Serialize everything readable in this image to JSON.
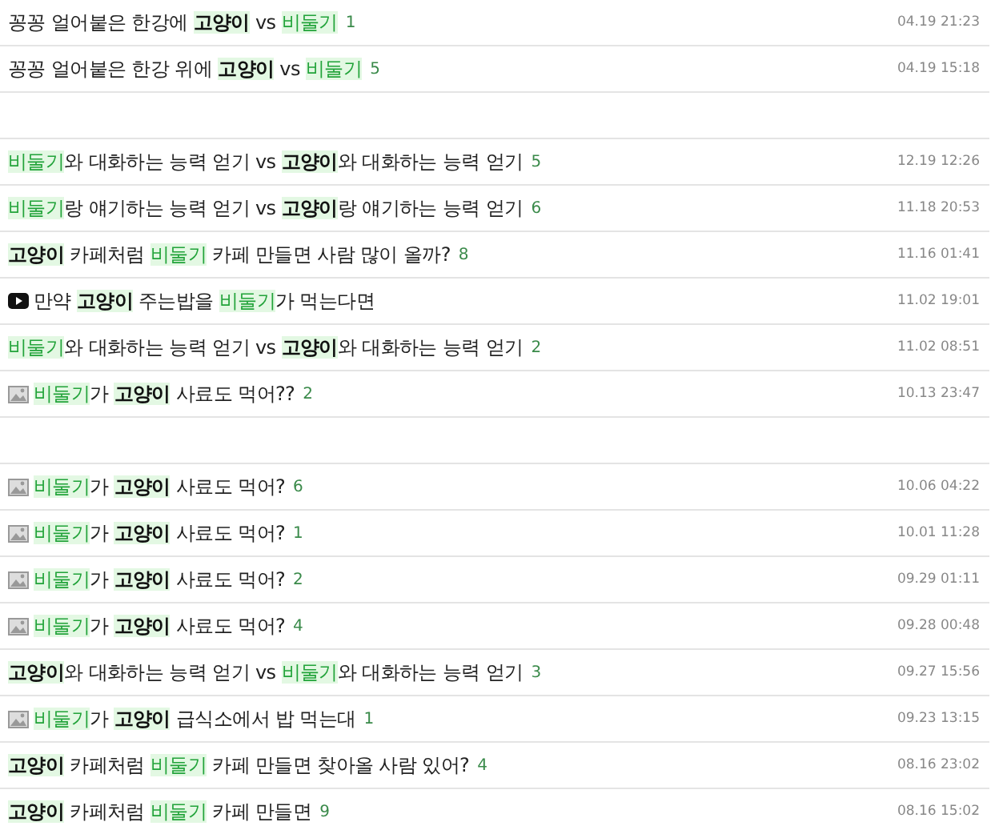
{
  "groups": [
    [
      {
        "kind": "text",
        "title": [
          {
            "kind": "text",
            "text": "꽁꽁 얼어붙은 한강에 "
          },
          {
            "kind": "bold",
            "text": "고양이"
          },
          {
            "kind": "text",
            "text": " vs "
          },
          {
            "kind": "green",
            "text": "비둘기"
          }
        ],
        "comments": "1",
        "date": "04.19 21:23"
      },
      {
        "kind": "text",
        "title": [
          {
            "kind": "text",
            "text": "꽁꽁 얼어붙은 한강 위에 "
          },
          {
            "kind": "bold",
            "text": "고양이"
          },
          {
            "kind": "text",
            "text": " vs "
          },
          {
            "kind": "green",
            "text": "비둘기"
          }
        ],
        "comments": "5",
        "date": "04.19 15:18"
      }
    ],
    [
      {
        "kind": "text",
        "title": [
          {
            "kind": "green",
            "text": "비둘기"
          },
          {
            "kind": "text",
            "text": "와 대화하는 능력 얻기 vs "
          },
          {
            "kind": "bold",
            "text": "고양이"
          },
          {
            "kind": "text",
            "text": "와 대화하는 능력 얻기"
          }
        ],
        "comments": "5",
        "date": "12.19 12:26"
      },
      {
        "kind": "text",
        "title": [
          {
            "kind": "green",
            "text": "비둘기"
          },
          {
            "kind": "text",
            "text": "랑 얘기하는 능력 얻기 vs "
          },
          {
            "kind": "bold",
            "text": "고양이"
          },
          {
            "kind": "text",
            "text": "랑 얘기하는 능력 얻기"
          }
        ],
        "comments": "6",
        "date": "11.18 20:53"
      },
      {
        "kind": "text",
        "title": [
          {
            "kind": "bold",
            "text": "고양이"
          },
          {
            "kind": "text",
            "text": " 카페처럼 "
          },
          {
            "kind": "green",
            "text": "비둘기"
          },
          {
            "kind": "text",
            "text": " 카페 만들면 사람 많이 올까?"
          }
        ],
        "comments": "8",
        "date": "11.16 01:41"
      },
      {
        "kind": "video",
        "title": [
          {
            "kind": "text",
            "text": "만약 "
          },
          {
            "kind": "bold",
            "text": "고양이"
          },
          {
            "kind": "text",
            "text": " 주는밥을 "
          },
          {
            "kind": "green",
            "text": "비둘기"
          },
          {
            "kind": "text",
            "text": "가 먹는다면"
          }
        ],
        "date": "11.02 19:01"
      },
      {
        "kind": "text",
        "title": [
          {
            "kind": "green",
            "text": "비둘기"
          },
          {
            "kind": "text",
            "text": "와 대화하는 능력 얻기 vs "
          },
          {
            "kind": "bold",
            "text": "고양이"
          },
          {
            "kind": "text",
            "text": "와 대화하는 능력 얻기"
          }
        ],
        "comments": "2",
        "date": "11.02 08:51"
      },
      {
        "kind": "image",
        "title": [
          {
            "kind": "green",
            "text": "비둘기"
          },
          {
            "kind": "text",
            "text": "가 "
          },
          {
            "kind": "bold",
            "text": "고양이"
          },
          {
            "kind": "text",
            "text": " 사료도 먹어??"
          }
        ],
        "comments": "2",
        "date": "10.13 23:47"
      }
    ],
    [
      {
        "kind": "image",
        "title": [
          {
            "kind": "green",
            "text": "비둘기"
          },
          {
            "kind": "text",
            "text": "가 "
          },
          {
            "kind": "bold",
            "text": "고양이"
          },
          {
            "kind": "text",
            "text": " 사료도 먹어?"
          }
        ],
        "comments": "6",
        "date": "10.06 04:22"
      },
      {
        "kind": "image",
        "title": [
          {
            "kind": "green",
            "text": "비둘기"
          },
          {
            "kind": "text",
            "text": "가 "
          },
          {
            "kind": "bold",
            "text": "고양이"
          },
          {
            "kind": "text",
            "text": " 사료도 먹어?"
          }
        ],
        "comments": "1",
        "date": "10.01 11:28"
      },
      {
        "kind": "image",
        "title": [
          {
            "kind": "green",
            "text": "비둘기"
          },
          {
            "kind": "text",
            "text": "가 "
          },
          {
            "kind": "bold",
            "text": "고양이"
          },
          {
            "kind": "text",
            "text": " 사료도 먹어?"
          }
        ],
        "comments": "2",
        "date": "09.29 01:11"
      },
      {
        "kind": "image",
        "title": [
          {
            "kind": "green",
            "text": "비둘기"
          },
          {
            "kind": "text",
            "text": "가 "
          },
          {
            "kind": "bold",
            "text": "고양이"
          },
          {
            "kind": "text",
            "text": " 사료도 먹어?"
          }
        ],
        "comments": "4",
        "date": "09.28 00:48"
      },
      {
        "kind": "text",
        "title": [
          {
            "kind": "bold",
            "text": "고양이"
          },
          {
            "kind": "text",
            "text": "와 대화하는 능력 얻기 vs "
          },
          {
            "kind": "green",
            "text": "비둘기"
          },
          {
            "kind": "text",
            "text": "와 대화하는 능력 얻기"
          }
        ],
        "comments": "3",
        "date": "09.27 15:56"
      },
      {
        "kind": "image",
        "title": [
          {
            "kind": "green",
            "text": "비둘기"
          },
          {
            "kind": "text",
            "text": "가 "
          },
          {
            "kind": "bold",
            "text": "고양이"
          },
          {
            "kind": "text",
            "text": " 급식소에서 밥 먹는대"
          }
        ],
        "comments": "1",
        "date": "09.23 13:15"
      },
      {
        "kind": "text",
        "title": [
          {
            "kind": "bold",
            "text": "고양이"
          },
          {
            "kind": "text",
            "text": " 카페처럼 "
          },
          {
            "kind": "green",
            "text": "비둘기"
          },
          {
            "kind": "text",
            "text": " 카페 만들면 찾아올 사람 있어?"
          }
        ],
        "comments": "4",
        "date": "08.16 23:02"
      },
      {
        "kind": "text",
        "title": [
          {
            "kind": "bold",
            "text": "고양이"
          },
          {
            "kind": "text",
            "text": " 카페처럼 "
          },
          {
            "kind": "green",
            "text": "비둘기"
          },
          {
            "kind": "text",
            "text": " 카페 만들면"
          }
        ],
        "comments": "9",
        "date": "08.16 15:02"
      }
    ]
  ]
}
